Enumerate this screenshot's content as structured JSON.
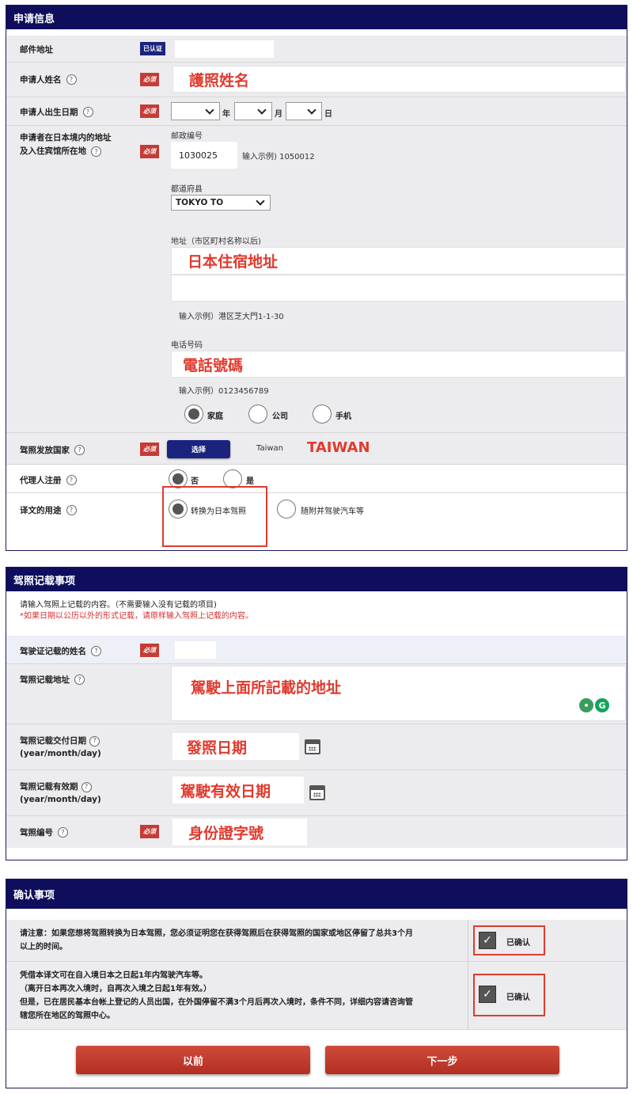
{
  "section1": {
    "title": "申请信息",
    "email": {
      "label": "邮件地址",
      "badge": "已认证"
    },
    "applicant_name": {
      "label": "申请人姓名",
      "annotation": "護照姓名"
    },
    "dob": {
      "label": "申请人出生日期",
      "year": "年",
      "month": "月",
      "day": "日"
    },
    "address": {
      "label_line1": "申请者在日本境内的地址",
      "label_line2": "及入住宾馆所在地",
      "postal_label": "邮政编号",
      "postal_value": "1030025",
      "postal_example": "输入示例) 1050012",
      "prefecture_label": "都道府县",
      "prefecture_value": "TOKYO TO",
      "address_label": "地址（市区町村名称以后)",
      "address_annotation": "日本住宿地址",
      "address_example": "输入示例）港区芝大門1-1-30",
      "phone_label": "电话号码",
      "phone_annotation": "電話號碼",
      "phone_example": "输入示例）0123456789",
      "phone_types": [
        "家庭",
        "公司",
        "手机"
      ]
    },
    "country": {
      "label": "驾照发放国家",
      "button": "选择",
      "value": "Taiwan",
      "annotation": "TAIWAN"
    },
    "agent": {
      "label": "代理人注册",
      "options": [
        "否",
        "是"
      ]
    },
    "purpose": {
      "label": "译文的用途",
      "options": [
        "转换为日本驾照",
        "随附并驾驶汽车等"
      ]
    },
    "required_badge": "必须",
    "help_icon": "?"
  },
  "section2": {
    "title": "驾照记载事项",
    "notice1": "请输入驾照上记载的内容。（不需要输入没有记载的项目)",
    "notice2": "*如果日期以公历以外的形式记载，请原样输入驾照上记载的内容。",
    "license_name": {
      "label": "驾驶证记载的姓名"
    },
    "license_address": {
      "label": "驾照记载地址",
      "annotation": "駕駛上面所記載的地址"
    },
    "issue_date": {
      "label": "驾照记载交付日期",
      "sublabel": "(year/month/day)",
      "annotation": "發照日期"
    },
    "expiry_date": {
      "label": "驾照记载有效期",
      "sublabel": "(year/month/day)",
      "annotation": "駕駛有效日期"
    },
    "license_number": {
      "label": "驾照编号",
      "annotation": "身份證字號"
    }
  },
  "section3": {
    "title": "确认事项",
    "confirm1_line1": "请注意：如果您想将驾照转换为日本驾照，您必须证明您在获得驾照后在获得驾照的国家或地区停留了总共3个月",
    "confirm1_line2": "以上的时间。",
    "confirm2_line1": "凭借本译文可在自入境日本之日起1年内驾驶汽车等。",
    "confirm2_line2": "（离开日本再次入境时，自再次入境之日起1年有效。）",
    "confirm2_line3": "但是，已在居民基本台帐上登记的人员出国，在外国停留不满3个月后再次入境时，条件不同，详细内容请咨询管",
    "confirm2_line4": "辖您所在地区的驾照中心。",
    "confirmed_label": "已确认",
    "check_mark": "✓",
    "prev_button": "以前",
    "next_button": "下一步"
  },
  "colors": {
    "header": "#0e0e5c",
    "required": "#c53b35",
    "annotation": "#e03a2e",
    "button": "#c0392b"
  }
}
